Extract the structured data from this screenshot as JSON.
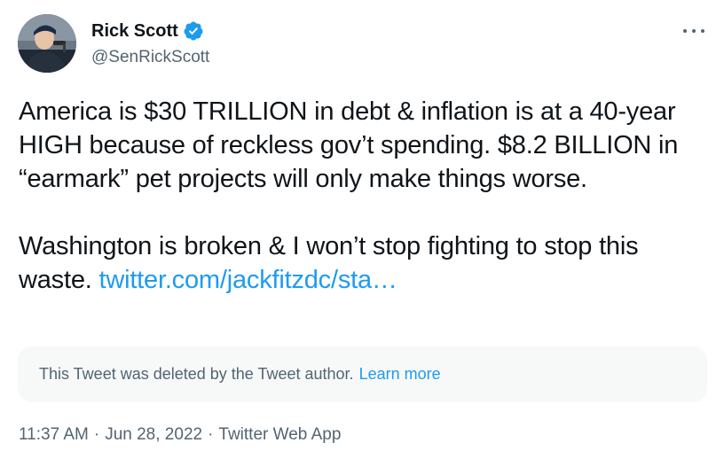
{
  "author": {
    "display_name": "Rick Scott",
    "handle": "@SenRickScott",
    "avatar_icon": "profile-photo",
    "verified_icon": "verified-badge-icon"
  },
  "tweet": {
    "paragraph1": "America is $30 TRILLION in debt & inflation is at a 40-year HIGH because of reckless gov’t spending. $8.2 BILLION in “earmark” pet projects will only make things worse.",
    "paragraph2_text": "Washington is broken & I won’t stop fighting to stop this waste. ",
    "link_text": "twitter.com/jackfitzdc/sta…"
  },
  "deleted_notice": {
    "message": "This Tweet was deleted by the Tweet author.",
    "learn_more": "Learn more"
  },
  "meta": {
    "time": "11:37 AM",
    "date": "Jun 28, 2022",
    "separator": "·",
    "source": "Twitter Web App"
  },
  "colors": {
    "link": "#1d9bf0",
    "secondary_text": "#536471",
    "primary_text": "#0f1419",
    "notice_background": "#f7f9f9"
  }
}
